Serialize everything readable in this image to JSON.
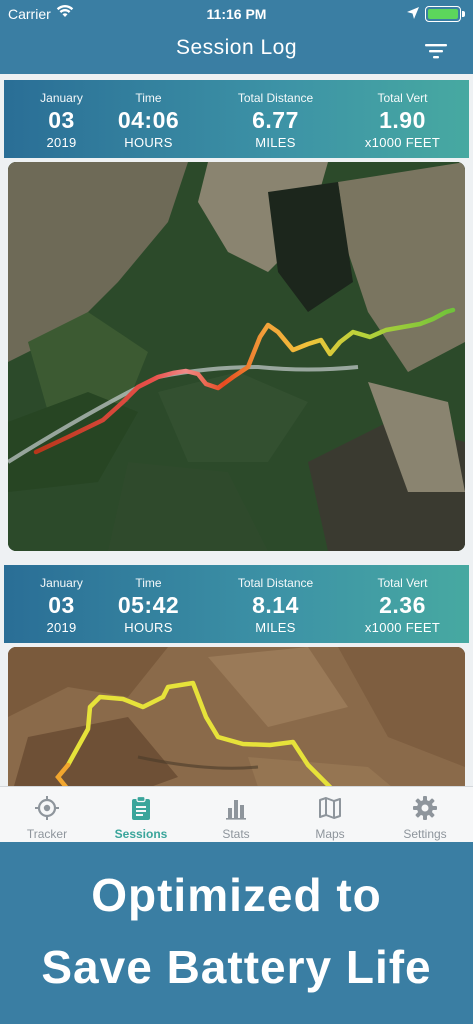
{
  "status_bar": {
    "carrier": "Carrier",
    "time": "11:16 PM",
    "icons": [
      "wifi-icon",
      "location-arrow-icon",
      "battery-icon"
    ]
  },
  "nav": {
    "title": "Session Log",
    "filter_icon": "filter-icon"
  },
  "sessions": [
    {
      "date": {
        "label": "January",
        "value": "03",
        "unit": "2019"
      },
      "time": {
        "label": "Time",
        "value": "04:06",
        "unit": "HOURS"
      },
      "distance": {
        "label": "Total Distance",
        "value": "6.77",
        "unit": "MILES"
      },
      "vert": {
        "label": "Total Vert",
        "value": "1.90",
        "unit": "x1000 FEET"
      }
    },
    {
      "date": {
        "label": "January",
        "value": "03",
        "unit": "2019"
      },
      "time": {
        "label": "Time",
        "value": "05:42",
        "unit": "HOURS"
      },
      "distance": {
        "label": "Total Distance",
        "value": "8.14",
        "unit": "MILES"
      },
      "vert": {
        "label": "Total Vert",
        "value": "2.36",
        "unit": "x1000 FEET"
      }
    }
  ],
  "tabs": [
    {
      "label": "Tracker",
      "icon": "crosshair-icon",
      "active": false
    },
    {
      "label": "Sessions",
      "icon": "clipboard-icon",
      "active": true
    },
    {
      "label": "Stats",
      "icon": "bar-chart-icon",
      "active": false
    },
    {
      "label": "Maps",
      "icon": "map-icon",
      "active": false
    },
    {
      "label": "Settings",
      "icon": "gear-icon",
      "active": false
    }
  ],
  "promo": {
    "line1": "Optimized to",
    "line2": "Save Battery Life"
  },
  "colors": {
    "brand": "#3a7ea3",
    "accent": "#3aa59b",
    "inactive_tab": "#8e959c"
  }
}
